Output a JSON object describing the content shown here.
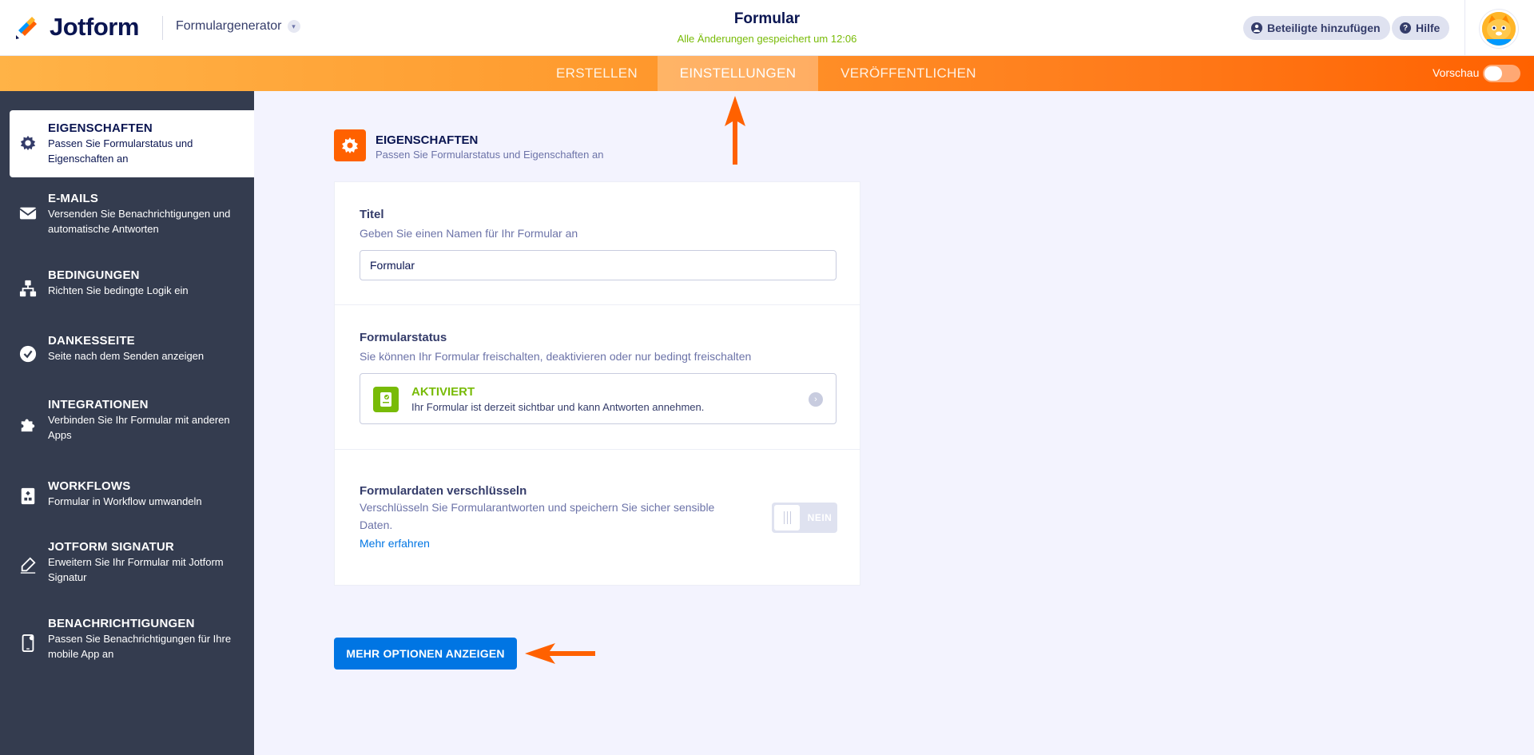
{
  "header": {
    "brand": "Jotform",
    "builder_label": "Formulargenerator",
    "form_title": "Formular",
    "save_status": "Alle Änderungen gespeichert um 12:06",
    "add_participants": "Beteiligte hinzufügen",
    "help": "Hilfe"
  },
  "nav": {
    "tabs": [
      {
        "label": "ERSTELLEN"
      },
      {
        "label": "EINSTELLUNGEN"
      },
      {
        "label": "VERÖFFENTLICHEN"
      }
    ],
    "preview_label": "Vorschau",
    "preview_on": false
  },
  "sidebar": {
    "items": [
      {
        "title": "EIGENSCHAFTEN",
        "desc": "Passen Sie Formularstatus und Eigenschaften an",
        "icon": "gear-icon",
        "active": true
      },
      {
        "title": "E-MAILS",
        "desc": "Versenden Sie Benachrichtigungen und automatische Antworten",
        "icon": "envelope-icon"
      },
      {
        "title": "BEDINGUNGEN",
        "desc": "Richten Sie bedingte Logik ein",
        "icon": "hierarchy-icon"
      },
      {
        "title": "DANKESSEITE",
        "desc": "Seite nach dem Senden anzeigen",
        "icon": "check-circle-icon"
      },
      {
        "title": "INTEGRATIONEN",
        "desc": "Verbinden Sie Ihr Formular mit anderen Apps",
        "icon": "puzzle-icon"
      },
      {
        "title": "WORKFLOWS",
        "desc": "Formular in Workflow umwandeln",
        "icon": "workflow-icon"
      },
      {
        "title": "JOTFORM SIGNATUR",
        "desc": "Erweitern Sie Ihr Formular mit Jotform Signatur",
        "icon": "pen-icon"
      },
      {
        "title": "BENACHRICHTIGUNGEN",
        "desc": "Passen Sie Benachrichtigungen für Ihre mobile App an",
        "icon": "mobile-icon"
      }
    ]
  },
  "section": {
    "title": "EIGENSCHAFTEN",
    "subtitle": "Passen Sie Formularstatus und Eigenschaften an"
  },
  "title_field": {
    "label": "Titel",
    "hint": "Geben Sie einen Namen für Ihr Formular an",
    "value": "Formular"
  },
  "form_status": {
    "label": "Formularstatus",
    "hint": "Sie können Ihr Formular freischalten, deaktivieren oder nur bedingt freischalten",
    "status_title": "AKTIVIERT",
    "status_desc": "Ihr Formular ist derzeit sichtbar und kann Antworten annehmen."
  },
  "encryption": {
    "label": "Formulardaten verschlüsseln",
    "hint": "Verschlüsseln Sie Formularantworten und speichern Sie sicher sensible Daten.",
    "learn_more": "Mehr erfahren",
    "toggle_label": "NEIN"
  },
  "more_options": "MEHR OPTIONEN ANZEIGEN",
  "colors": {
    "orange": "#ff6100",
    "navy": "#0a1551",
    "sidebar": "#343c4f",
    "green": "#78bb07",
    "blue": "#0075e3"
  }
}
